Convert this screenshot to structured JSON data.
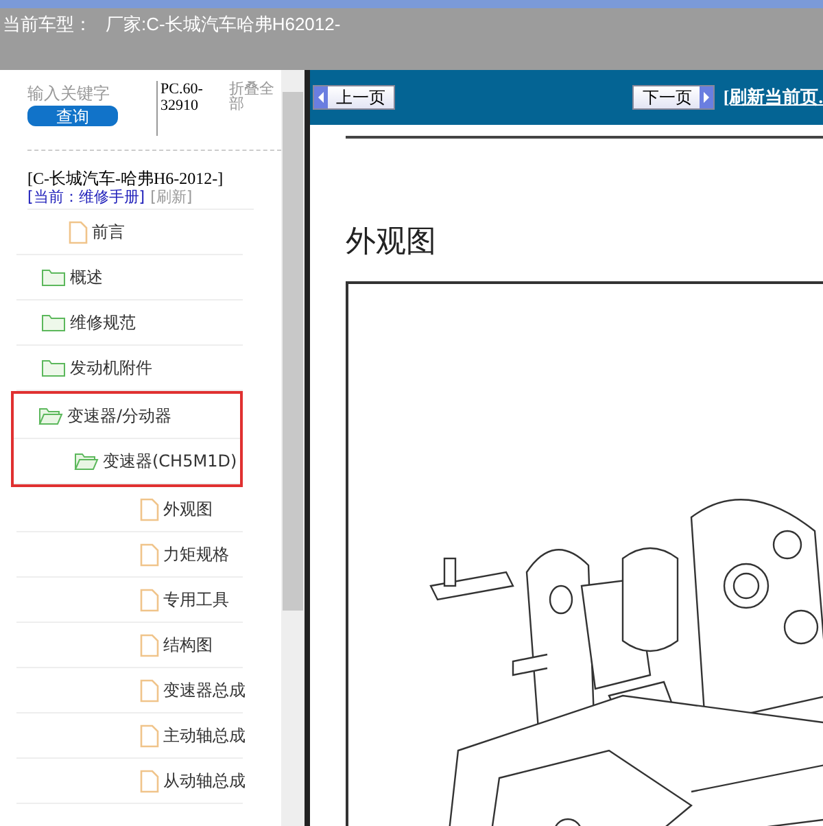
{
  "header": {
    "label": "当前车型：",
    "value": "厂家:C-长城汽车哈弗H62012-"
  },
  "search": {
    "placeholder": "输入关键字",
    "button": "查询",
    "code": "PC.60-32910",
    "collapse_all": "折叠全部"
  },
  "manual": {
    "title": "[C-长城汽车-哈弗H6-2012-]",
    "current": "[当前：维修手册]",
    "refresh": "[刷新]"
  },
  "tree": [
    {
      "label": "前言",
      "kind": "doc"
    },
    {
      "label": "概述",
      "kind": "folder",
      "expanded": false
    },
    {
      "label": "维修规范",
      "kind": "folder",
      "expanded": false
    },
    {
      "label": "发动机附件",
      "kind": "folder",
      "expanded": false
    },
    {
      "label": "变速器/分动器",
      "kind": "folder",
      "expanded": true,
      "highlighted": true,
      "children": [
        {
          "label": "变速器(CH5M1D)",
          "kind": "folder",
          "expanded": true,
          "highlighted": true,
          "children": [
            {
              "label": "外观图",
              "kind": "doc"
            },
            {
              "label": "力矩规格",
              "kind": "doc"
            },
            {
              "label": "专用工具",
              "kind": "doc"
            },
            {
              "label": "结构图",
              "kind": "doc"
            },
            {
              "label": "变速器总成",
              "kind": "doc"
            },
            {
              "label": "主动轴总成",
              "kind": "doc"
            },
            {
              "label": "从动轴总成",
              "kind": "doc"
            }
          ]
        }
      ]
    }
  ],
  "toolbar": {
    "prev": "上一页",
    "next": "下一页",
    "refresh": "[刷新当前页."
  },
  "document": {
    "heading": "外观图"
  }
}
